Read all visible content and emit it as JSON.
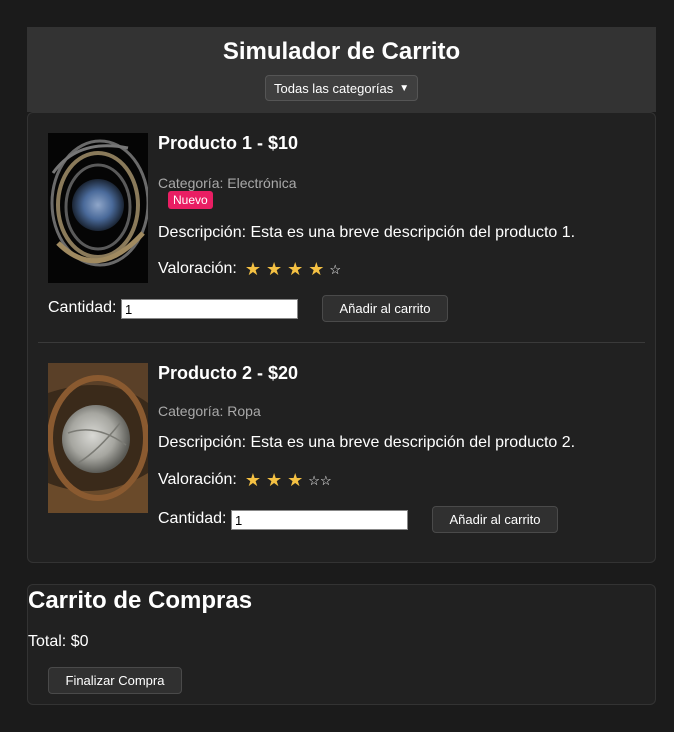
{
  "header": {
    "title": "Simulador de Carrito",
    "category_select": "Todas las categorías"
  },
  "products": [
    {
      "title": "Producto 1 - $10",
      "category": "Categoría: Electrónica",
      "badge": "Nuevo",
      "description": "Descripción: Esta es una breve descripción del producto 1.",
      "rating_label": "Valoración:",
      "rating": 4,
      "rating_max": 5,
      "qty_label": "Cantidad:",
      "qty_value": "1",
      "add_label": "Añadir al carrito"
    },
    {
      "title": "Producto 2 - $20",
      "category": "Categoría: Ropa",
      "description": "Descripción: Esta es una breve descripción del producto 2.",
      "rating_label": "Valoración:",
      "rating": 3,
      "rating_max": 5,
      "qty_label": "Cantidad:",
      "qty_value": "1",
      "add_label": "Añadir al carrito"
    }
  ],
  "cart": {
    "title": "Carrito de Compras",
    "total": "Total: $0",
    "checkout_label": "Finalizar Compra"
  },
  "colors": {
    "background": "#1b1b1b",
    "header_bg": "#333333",
    "card_bg": "#212121",
    "badge": "#e91e63",
    "star": "#f5c143"
  },
  "icons": [
    "chevron-down-icon",
    "star-full-icon",
    "star-empty-icon"
  ]
}
